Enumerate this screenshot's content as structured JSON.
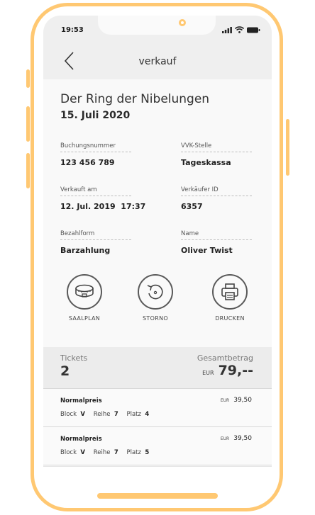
{
  "status_bar": {
    "time": "19:53"
  },
  "header": {
    "title": "verkauf"
  },
  "event": {
    "title": "Der Ring der Nibelungen",
    "date": "15. Juli 2020"
  },
  "details": [
    {
      "label": "Buchungsnummer",
      "value": "123 456 789"
    },
    {
      "label": "VVK-Stelle",
      "value": "Tageskassa"
    },
    {
      "label": "Verkauft am",
      "value": "12. Jul. 2019  17:37"
    },
    {
      "label": "Verkäufer ID",
      "value": "6357"
    },
    {
      "label": "Bezahlform",
      "value": "Barzahlung"
    },
    {
      "label": "Name",
      "value": "Oliver Twist"
    }
  ],
  "actions": [
    {
      "label": "SAALPLAN",
      "icon": "seating-plan-icon"
    },
    {
      "label": "STORNO",
      "icon": "undo-icon"
    },
    {
      "label": "DRUCKEN",
      "icon": "printer-icon"
    }
  ],
  "summary": {
    "tickets_label": "Tickets",
    "tickets_count": "2",
    "total_label": "Gesamtbetrag",
    "total_currency": "EUR",
    "total_amount": "79,--"
  },
  "tickets": [
    {
      "type": "Normalpreis",
      "currency": "EUR",
      "price": "39,50",
      "block_label": "Block",
      "block": "V",
      "row_label": "Reihe",
      "row": "7",
      "seat_label": "Platz",
      "seat": "4"
    },
    {
      "type": "Normalpreis",
      "currency": "EUR",
      "price": "39,50",
      "block_label": "Block",
      "block": "V",
      "row_label": "Reihe",
      "row": "7",
      "seat_label": "Platz",
      "seat": "5"
    }
  ],
  "colors": {
    "frame": "#ffc872",
    "header_bg": "#efefef",
    "summary_bg": "#ececec",
    "text": "#2b2b2b"
  }
}
